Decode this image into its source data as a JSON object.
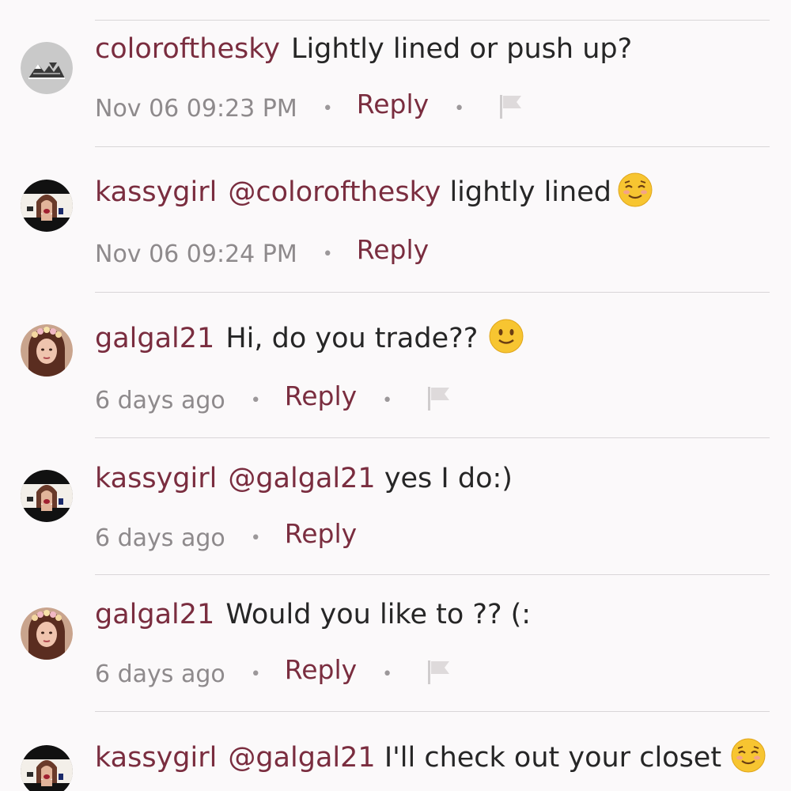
{
  "comments": [
    {
      "username": "colorofthesky",
      "mention": "",
      "text": "Lightly lined or push up?",
      "timestamp": "Nov 06 09:23 PM",
      "reply_label": "Reply",
      "emoji": "",
      "has_flag": true,
      "avatar": "mountain-logo"
    },
    {
      "username": "kassygirl",
      "mention": "@colorofthesky",
      "text": "lightly lined",
      "timestamp": "Nov 06 09:24 PM",
      "reply_label": "Reply",
      "emoji": "relieved-face",
      "has_flag": false,
      "avatar": "kassygirl-photo"
    },
    {
      "username": "galgal21",
      "mention": "",
      "text": "Hi, do you trade??",
      "timestamp": "6 days ago",
      "reply_label": "Reply",
      "emoji": "slightly-smiling-face",
      "has_flag": true,
      "avatar": "galgal21-photo"
    },
    {
      "username": "kassygirl",
      "mention": "@galgal21",
      "text": "yes I do:)",
      "timestamp": "6 days ago",
      "reply_label": "Reply",
      "emoji": "",
      "has_flag": false,
      "avatar": "kassygirl-photo"
    },
    {
      "username": "galgal21",
      "mention": "",
      "text": "Would you like to ?? (:",
      "timestamp": "6 days ago",
      "reply_label": "Reply",
      "emoji": "",
      "has_flag": true,
      "avatar": "galgal21-photo"
    },
    {
      "username": "kassygirl",
      "mention": "@galgal21",
      "text": "I'll check out your closet",
      "timestamp": "",
      "reply_label": "",
      "emoji": "relieved-face",
      "has_flag": false,
      "avatar": "kassygirl-photo"
    }
  ],
  "colors": {
    "username": "#7a2d3f",
    "text": "#262626",
    "meta": "#8e8a8c",
    "divider": "#d9d6d8",
    "background": "#fbf9fa"
  }
}
